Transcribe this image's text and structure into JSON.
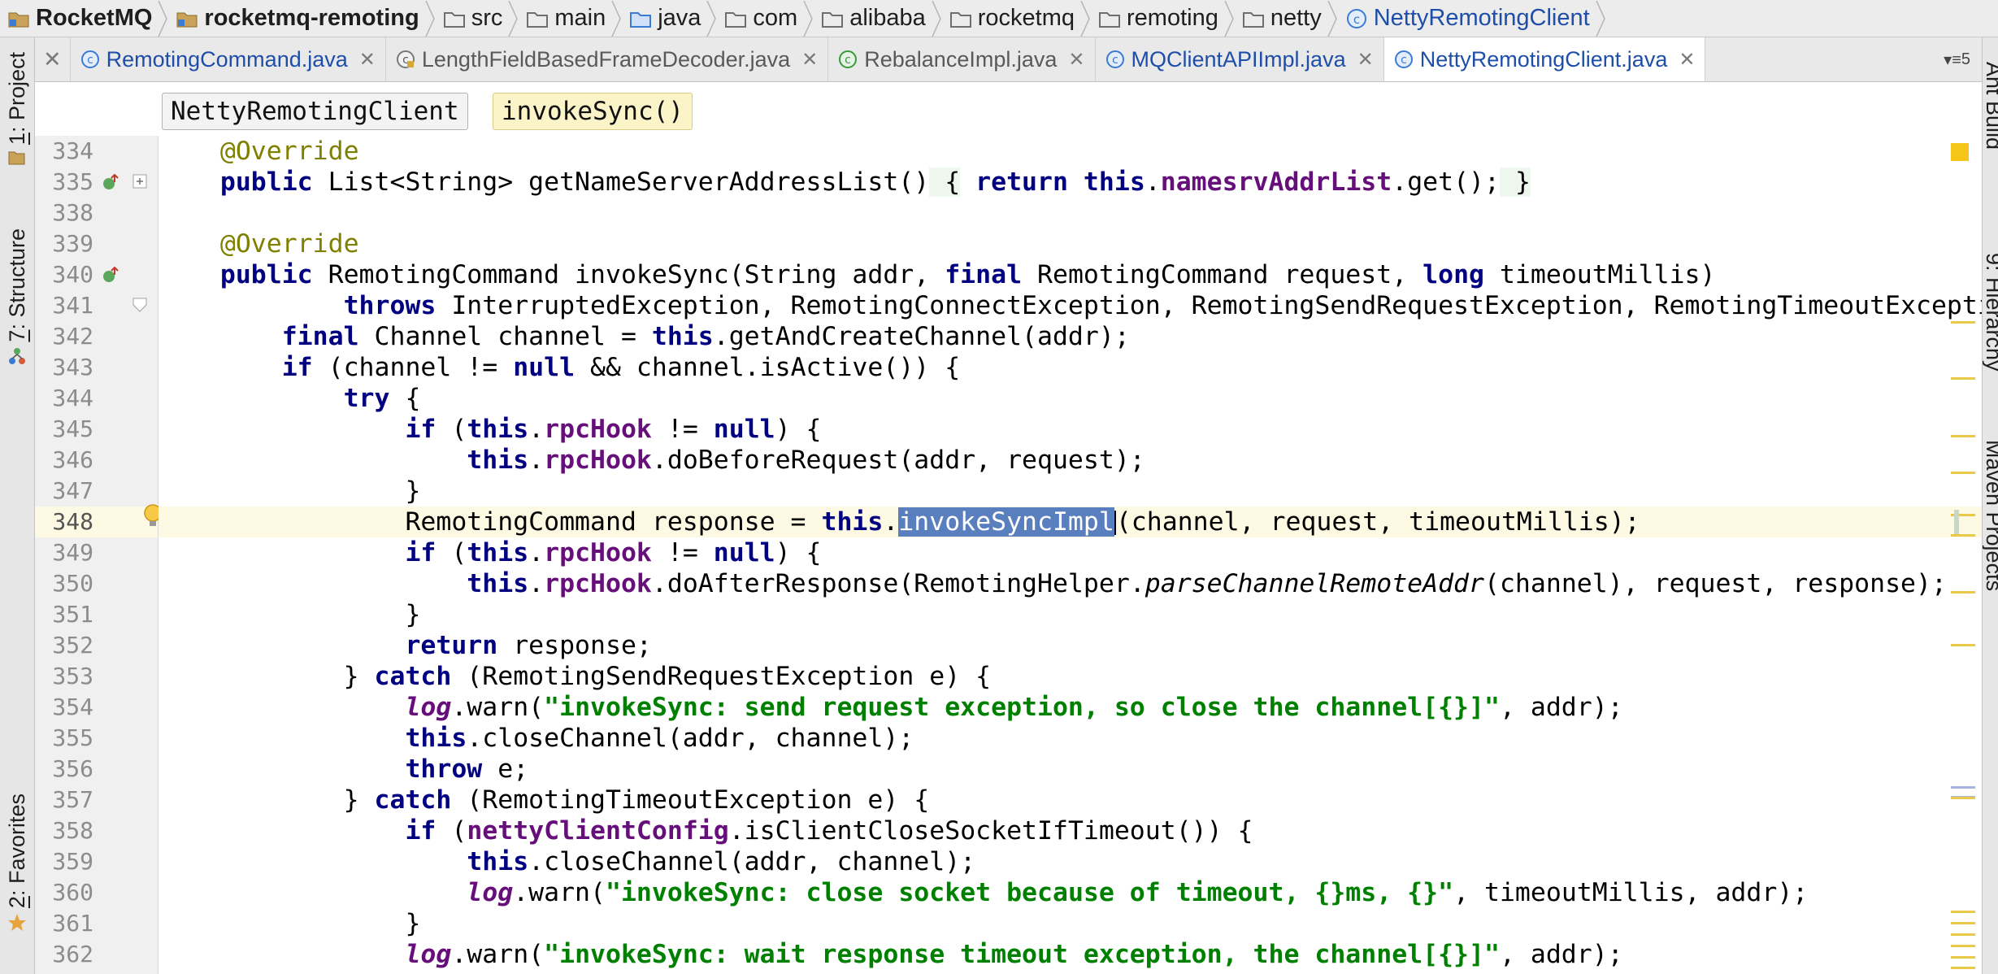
{
  "navigation": {
    "crumbs": [
      {
        "label": "RocketMQ",
        "kind": "project"
      },
      {
        "label": "rocketmq-remoting",
        "kind": "module"
      },
      {
        "label": "src",
        "kind": "folder"
      },
      {
        "label": "main",
        "kind": "folder"
      },
      {
        "label": "java",
        "kind": "source-folder"
      },
      {
        "label": "com",
        "kind": "folder"
      },
      {
        "label": "alibaba",
        "kind": "folder"
      },
      {
        "label": "rocketmq",
        "kind": "folder"
      },
      {
        "label": "remoting",
        "kind": "folder"
      },
      {
        "label": "netty",
        "kind": "folder"
      },
      {
        "label": "NettyRemotingClient",
        "kind": "class"
      }
    ]
  },
  "tool_windows": {
    "left": {
      "project": {
        "number": "1",
        "label": ": Project"
      },
      "structure": {
        "number": "7",
        "label": ": Structure"
      },
      "favorites": {
        "number": "2",
        "label": ": Favorites"
      }
    },
    "right": {
      "ant": "Ant Build",
      "hierarchy": "9: Hierarchy",
      "maven": "Maven Projects"
    }
  },
  "tabs": [
    {
      "label": "RemotingCommand.java",
      "icon": "class-icon",
      "active": false
    },
    {
      "label": "LengthFieldBasedFrameDecoder.java",
      "icon": "class-locked-icon",
      "active": false
    },
    {
      "label": "RebalanceImpl.java",
      "icon": "abstract-class-icon",
      "active": false
    },
    {
      "label": "MQClientAPIImpl.java",
      "icon": "class-icon",
      "active": false
    },
    {
      "label": "NettyRemotingClient.java",
      "icon": "class-icon",
      "active": true
    }
  ],
  "tab_overflow_count": "5",
  "editor_breadcrumb": {
    "class_name": "NettyRemotingClient",
    "method_name": "invokeSync()"
  },
  "editor": {
    "line_numbers": [
      "334",
      "335",
      "338",
      "339",
      "340",
      "341",
      "342",
      "343",
      "344",
      "345",
      "346",
      "347",
      "348",
      "349",
      "350",
      "351",
      "352",
      "353",
      "354",
      "355",
      "356",
      "357",
      "358",
      "359",
      "360",
      "361",
      "362"
    ],
    "current_line": "348"
  },
  "colors": {
    "keyword": "#000080",
    "annotation": "#808000",
    "field": "#660e7a",
    "string": "#008000",
    "selection": "#5a7fbf",
    "current_line": "#fdf9e3"
  },
  "code": {
    "l334": {
      "annotation": "@Override"
    },
    "l335": {
      "kw1": "public",
      "text1": " List<String> getNameServerAddressList()",
      "fold_open": " {",
      "kw2": "return",
      "kw3": "this",
      "text2": ".",
      "field": "namesrvAddrList",
      "text3": ".get();",
      "fold_close": " }"
    },
    "l339": {
      "annotation": "@Override"
    },
    "l340": {
      "kw1": "public",
      "text1": " RemotingCommand invokeSync(String addr, ",
      "kw2": "final",
      "text2": " RemotingCommand request, ",
      "kw3": "long",
      "text3": " timeoutMillis)"
    },
    "l341": {
      "kw1": "throws",
      "text1": " InterruptedException, RemotingConnectException, RemotingSendRequestException, RemotingTimeoutException {"
    },
    "l342": {
      "kw1": "final",
      "text1": " Channel channel = ",
      "kw2": "this",
      "text2": ".getAndCreateChannel(addr);"
    },
    "l343": {
      "kw1": "if",
      "text1": " (channel != ",
      "kw2": "null",
      "text2": " && channel.isActive()) {"
    },
    "l344": {
      "kw1": "try",
      "text1": " {"
    },
    "l345": {
      "kw1": "if",
      "text1": " (",
      "kw2": "this",
      "text2": ".",
      "field": "rpcHook",
      "text3": " != ",
      "kw3": "null",
      "text4": ") {"
    },
    "l346": {
      "kw1": "this",
      "text1": ".",
      "field": "rpcHook",
      "text2": ".doBeforeRequest(addr, request);"
    },
    "l347": {
      "text1": "}"
    },
    "l348": {
      "text1": "RemotingCommand response = ",
      "kw1": "this",
      "text2": ".",
      "selected": "invokeSyncImpl",
      "text3": "(channel, request, timeoutMillis);"
    },
    "l349": {
      "kw1": "if",
      "text1": " (",
      "kw2": "this",
      "text2": ".",
      "field": "rpcHook",
      "text3": " != ",
      "kw3": "null",
      "text4": ") {"
    },
    "l350": {
      "kw1": "this",
      "text1": ".",
      "field": "rpcHook",
      "text2": ".doAfterResponse(RemotingHelper.",
      "italic": "parseChannelRemoteAddr",
      "text3": "(channel), request, response);"
    },
    "l351": {
      "text1": "}"
    },
    "l352": {
      "kw1": "return",
      "text1": " response;"
    },
    "l353": {
      "text1": "} ",
      "kw1": "catch",
      "text2": " (RemotingSendRequestException e) {"
    },
    "l354": {
      "static_field": "log",
      "text1": ".warn(",
      "string": "\"invokeSync: send request exception, so close the channel[{}]\"",
      "text2": ", addr);"
    },
    "l355": {
      "kw1": "this",
      "text1": ".closeChannel(addr, channel);"
    },
    "l356": {
      "kw1": "throw",
      "text1": " e;"
    },
    "l357": {
      "text1": "} ",
      "kw1": "catch",
      "text2": " (RemotingTimeoutException e) {"
    },
    "l358": {
      "kw1": "if",
      "text1": " (",
      "field": "nettyClientConfig",
      "text2": ".isClientCloseSocketIfTimeout()) {"
    },
    "l359": {
      "kw1": "this",
      "text1": ".closeChannel(addr, channel);"
    },
    "l360": {
      "static_field": "log",
      "text1": ".warn(",
      "string": "\"invokeSync: close socket because of timeout, {}ms, {}\"",
      "text2": ", timeoutMillis, addr);"
    },
    "l361": {
      "text1": "}"
    },
    "l362": {
      "static_field": "log",
      "text1": ".warn(",
      "string": "\"invokeSync: wait response timeout exception, the channel[{}]\"",
      "text2": ", addr);"
    }
  }
}
